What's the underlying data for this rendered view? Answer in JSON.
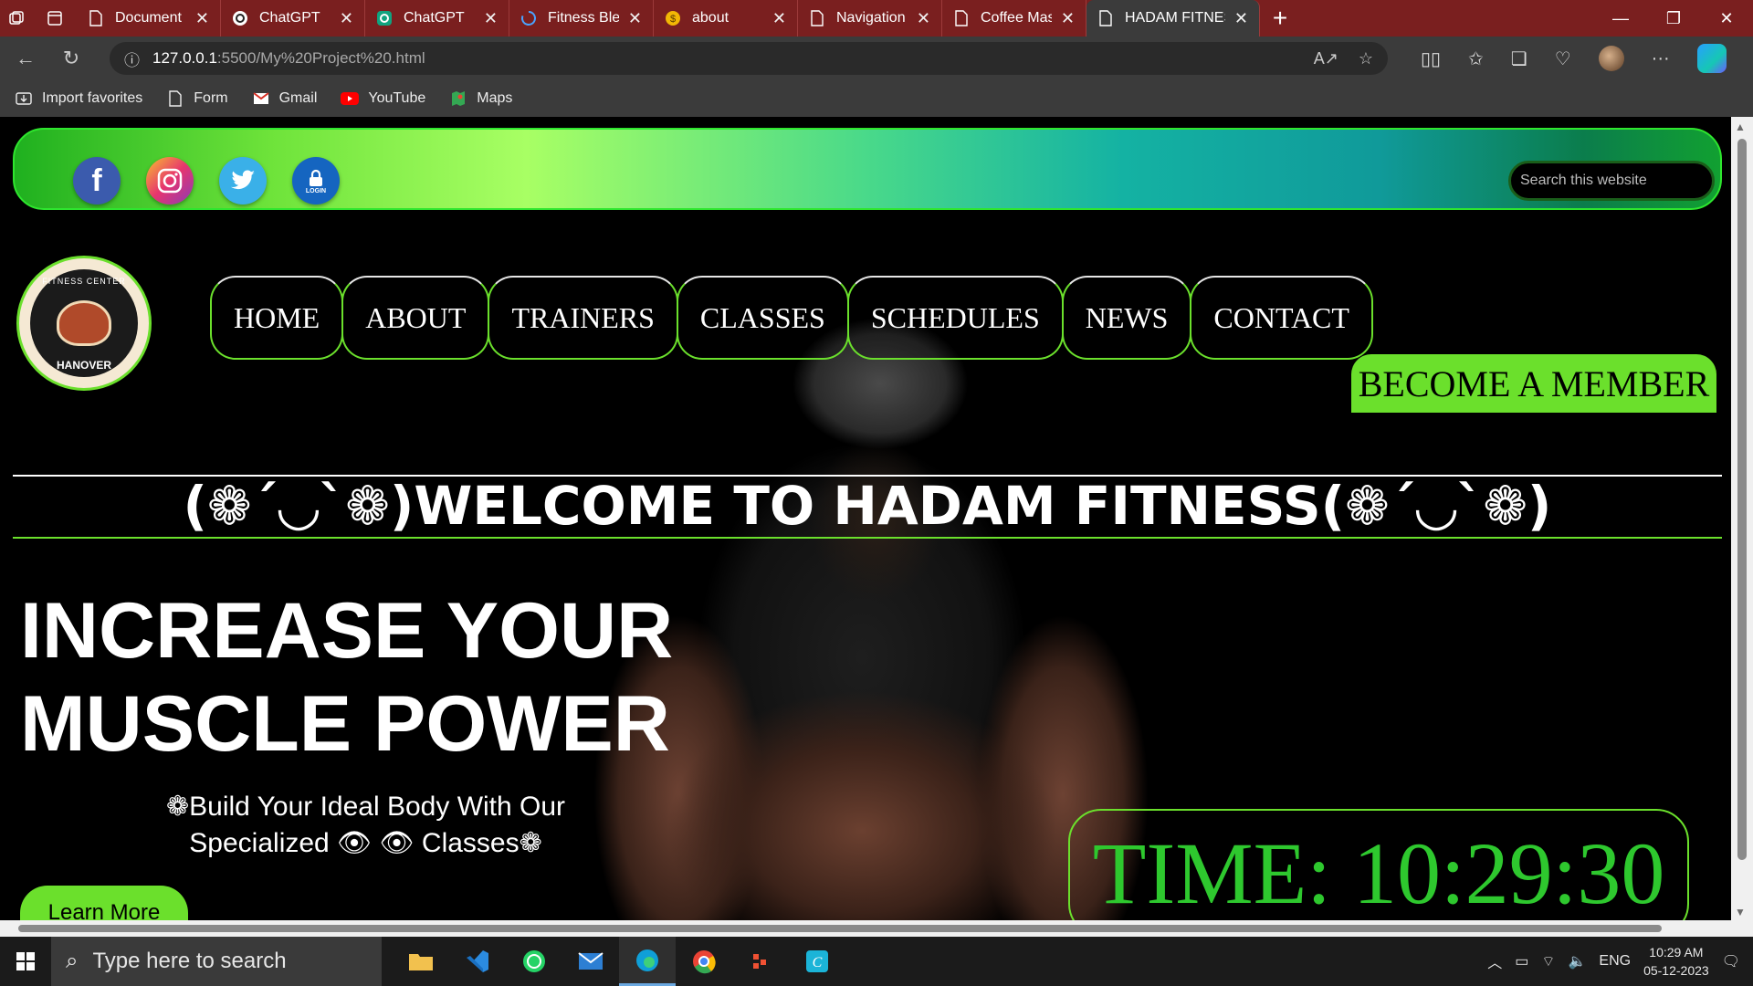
{
  "browser": {
    "tabs": [
      {
        "title": "Document",
        "icon": "page-icon"
      },
      {
        "title": "ChatGPT",
        "icon": "chatgpt-icon"
      },
      {
        "title": "ChatGPT",
        "icon": "chatgpt-icon"
      },
      {
        "title": "Fitness Blender",
        "icon": "loading-icon"
      },
      {
        "title": "about",
        "icon": "coin-icon"
      },
      {
        "title": "Navigation menu",
        "icon": "page-icon"
      },
      {
        "title": "Coffee Masters",
        "icon": "page-icon"
      },
      {
        "title": "HADAM FITNESS",
        "icon": "page-icon",
        "active": true
      }
    ],
    "address": {
      "host": "127.0.0.1",
      "path": ":5500/My%20Project%20.html"
    },
    "favorites": [
      "Import favorites",
      "Form",
      "Gmail",
      "YouTube",
      "Maps"
    ]
  },
  "site": {
    "search_placeholder": "Search this website",
    "social": {
      "facebook": "f",
      "login_label": "LOGIN"
    },
    "logo": {
      "top_text": "FITNESS CENTER",
      "bottom_text": "HANOVER"
    },
    "nav": [
      "HOME",
      "ABOUT",
      "TRAINERS",
      "CLASSES",
      "SCHEDULES",
      "NEWS",
      "CONTACT"
    ],
    "member_button": "BECOME A MEMBER",
    "welcome": "(❁´◡`❁)WELCOME TO HADAM FITNESS(❁´◡`❁)",
    "headline_line1": "INCREASE YOUR",
    "headline_line2": "MUSCLE POWER",
    "subline_line1": "❁Build Your Ideal Body With Our",
    "subline_line2": "Specialized 👁 👁  Classes❁",
    "learn_more": "Learn More",
    "clock": "TIME: 10:29:30"
  },
  "taskbar": {
    "search_placeholder": "Type here to search",
    "lang": "ENG",
    "time": "10:29 AM",
    "date": "05-12-2023"
  },
  "colors": {
    "accent_green": "#6be02c",
    "tabbar": "#7a1f1f",
    "chrome": "#3b3b3b"
  }
}
